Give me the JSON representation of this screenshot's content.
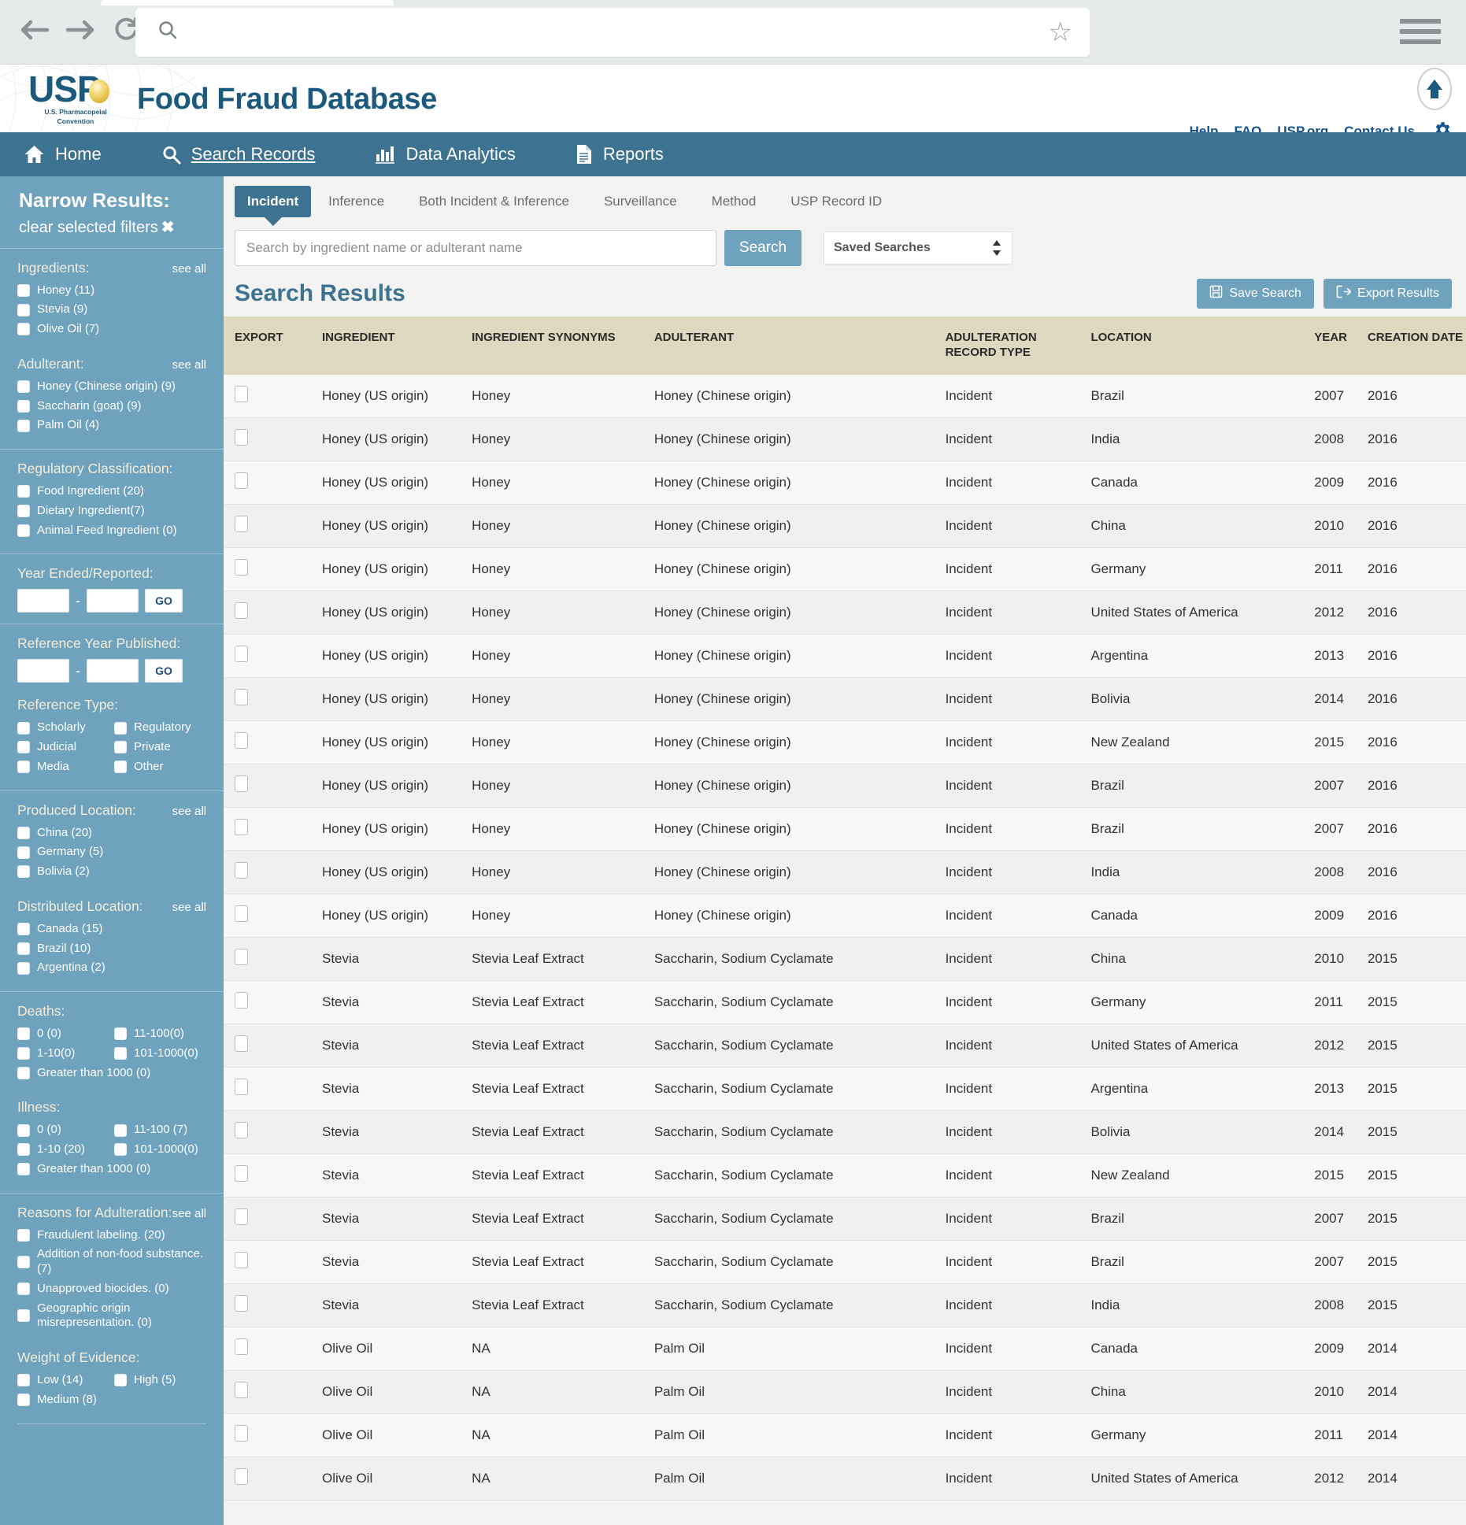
{
  "browser": {
    "url_value": "",
    "back_icon": "back-arrow-icon",
    "forward_icon": "forward-arrow-icon",
    "reload_icon": "reload-icon",
    "search_icon": "search-icon",
    "bookmark_icon": "star-icon",
    "menu_icon": "hamburger-menu-icon"
  },
  "header": {
    "logo_word": "USP",
    "logo_sub_line1": "U.S. Pharmacopeial",
    "logo_sub_line2": "Convention",
    "site_title": "Food Fraud Database",
    "links": [
      "Help",
      "FAQ",
      "USP.org",
      "Contact Us"
    ],
    "gear_icon": "gear-icon",
    "badge_icon": "up-arrow-badge-icon"
  },
  "nav": {
    "items": [
      {
        "label": "Home",
        "icon": "home-icon",
        "active": false
      },
      {
        "label": "Search Records",
        "icon": "magnifier-icon",
        "active": true
      },
      {
        "label": "Data Analytics",
        "icon": "bar-chart-icon",
        "active": false
      },
      {
        "label": "Reports",
        "icon": "document-icon",
        "active": false
      }
    ]
  },
  "sidebar": {
    "title": "Narrow Results:",
    "clear_label": "clear selected filters",
    "clear_icon": "✖",
    "see_all_label": "see all",
    "sections": [
      {
        "name": "ingredients",
        "label": "Ingredients:",
        "see_all": true,
        "options": [
          "Honey (11)",
          "Stevia (9)",
          "Olive Oil (7)"
        ]
      },
      {
        "name": "adulterant",
        "label": "Adulterant:",
        "see_all": true,
        "options": [
          "Honey (Chinese origin) (9)",
          "Saccharin (goat) (9)",
          "Palm Oil (4)"
        ]
      },
      {
        "name": "regulatory-classification",
        "label": "Regulatory Classification:",
        "see_all": false,
        "options": [
          "Food Ingredient (20)",
          "Dietary Ingredient(7)",
          "Animal Feed Ingredient (0)"
        ]
      },
      {
        "name": "produced-location",
        "label": "Produced Location:",
        "see_all": true,
        "options": [
          "China (20)",
          "Germany (5)",
          "Bolivia (2)"
        ]
      },
      {
        "name": "distributed-location",
        "label": "Distributed Location:",
        "see_all": true,
        "options": [
          "Canada (15)",
          "Brazil (10)",
          "Argentina (2)"
        ]
      },
      {
        "name": "reasons-for-adulteration",
        "label": "Reasons for Adulteration:",
        "see_all": true,
        "options": [
          "Fraudulent labeling. (20)",
          "Addition of non-food substance. (7)",
          "Unapproved biocides. (0)",
          "Geographic origin misrepresentation. (0)"
        ]
      }
    ],
    "year_ended": {
      "label": "Year Ended/Reported:",
      "from": "",
      "to": "",
      "go_label": "GO",
      "dash": "-"
    },
    "ref_year": {
      "label": "Reference Year Published:",
      "from": "",
      "to": "",
      "go_label": "GO",
      "dash": "-"
    },
    "reference_type": {
      "label": "Reference Type:",
      "options": [
        "Scholarly",
        "Regulatory",
        "Judicial",
        "Private",
        "Media",
        "Other"
      ]
    },
    "deaths": {
      "label": "Deaths:",
      "options": [
        "0 (0)",
        "11-100(0)",
        "1-10(0)",
        "101-1000(0)",
        "Greater than 1000 (0)"
      ]
    },
    "illness": {
      "label": "Illness:",
      "options": [
        "0 (0)",
        "11-100 (7)",
        "1-10 (20)",
        "101-1000(0)",
        "Greater than 1000 (0)"
      ]
    },
    "weight_of_evidence": {
      "label": "Weight of Evidence:",
      "options": [
        "Low (14)",
        "High (5)",
        "Medium (8)"
      ]
    }
  },
  "main": {
    "tabs": [
      {
        "label": "Incident",
        "active": true
      },
      {
        "label": "Inference",
        "active": false
      },
      {
        "label": "Both Incident & Inference",
        "active": false
      },
      {
        "label": "Surveillance",
        "active": false
      },
      {
        "label": "Method",
        "active": false
      },
      {
        "label": "USP Record ID",
        "active": false
      }
    ],
    "search": {
      "placeholder": "Search by ingredient name or adulterant name",
      "value": "",
      "button_label": "Search"
    },
    "saved_searches": {
      "selected": "Saved Searches",
      "spinner_icon": "updown-spinner-icon"
    },
    "results_title": "Search Results",
    "save_search_label": "Save Search",
    "save_search_icon": "floppy-disk-icon",
    "export_results_label": "Export Results",
    "export_results_icon": "export-icon"
  },
  "table": {
    "columns": [
      "EXPORT",
      "INGREDIENT",
      "INGREDIENT SYNONYMS",
      "ADULTERANT",
      "ADULTERATION RECORD TYPE",
      "LOCATION",
      "YEAR",
      "CREATION DATE"
    ],
    "rows": [
      [
        "Honey (US origin)",
        "Honey",
        "Honey (Chinese origin)",
        "Incident",
        "Brazil",
        "2007",
        "2016"
      ],
      [
        "Honey (US origin)",
        "Honey",
        "Honey (Chinese origin)",
        "Incident",
        "India",
        "2008",
        "2016"
      ],
      [
        "Honey (US origin)",
        "Honey",
        "Honey (Chinese origin)",
        "Incident",
        "Canada",
        "2009",
        "2016"
      ],
      [
        "Honey (US origin)",
        "Honey",
        "Honey (Chinese origin)",
        "Incident",
        "China",
        "2010",
        "2016"
      ],
      [
        "Honey (US origin)",
        "Honey",
        "Honey (Chinese origin)",
        "Incident",
        "Germany",
        "2011",
        "2016"
      ],
      [
        "Honey (US origin)",
        "Honey",
        "Honey (Chinese origin)",
        "Incident",
        "United States of America",
        "2012",
        "2016"
      ],
      [
        "Honey (US origin)",
        "Honey",
        "Honey (Chinese origin)",
        "Incident",
        "Argentina",
        "2013",
        "2016"
      ],
      [
        "Honey (US origin)",
        "Honey",
        "Honey (Chinese origin)",
        "Incident",
        "Bolivia",
        "2014",
        "2016"
      ],
      [
        "Honey (US origin)",
        "Honey",
        "Honey (Chinese origin)",
        "Incident",
        "New Zealand",
        "2015",
        "2016"
      ],
      [
        "Honey (US origin)",
        "Honey",
        "Honey (Chinese origin)",
        "Incident",
        "Brazil",
        "2007",
        "2016"
      ],
      [
        "Honey (US origin)",
        "Honey",
        "Honey (Chinese origin)",
        "Incident",
        "Brazil",
        "2007",
        "2016"
      ],
      [
        "Honey (US origin)",
        "Honey",
        "Honey (Chinese origin)",
        "Incident",
        "India",
        "2008",
        "2016"
      ],
      [
        "Honey (US origin)",
        "Honey",
        "Honey (Chinese origin)",
        "Incident",
        "Canada",
        "2009",
        "2016"
      ],
      [
        "Stevia",
        "Stevia Leaf Extract",
        "Saccharin, Sodium Cyclamate",
        "Incident",
        "China",
        "2010",
        "2015"
      ],
      [
        "Stevia",
        "Stevia Leaf Extract",
        "Saccharin, Sodium Cyclamate",
        "Incident",
        "Germany",
        "2011",
        "2015"
      ],
      [
        "Stevia",
        "Stevia Leaf Extract",
        "Saccharin, Sodium Cyclamate",
        "Incident",
        "United States of America",
        "2012",
        "2015"
      ],
      [
        "Stevia",
        "Stevia Leaf Extract",
        "Saccharin, Sodium Cyclamate",
        "Incident",
        "Argentina",
        "2013",
        "2015"
      ],
      [
        "Stevia",
        "Stevia Leaf Extract",
        "Saccharin, Sodium Cyclamate",
        "Incident",
        "Bolivia",
        "2014",
        "2015"
      ],
      [
        "Stevia",
        "Stevia Leaf Extract",
        "Saccharin, Sodium Cyclamate",
        "Incident",
        "New Zealand",
        "2015",
        "2015"
      ],
      [
        "Stevia",
        "Stevia Leaf Extract",
        "Saccharin, Sodium Cyclamate",
        "Incident",
        "Brazil",
        "2007",
        "2015"
      ],
      [
        "Stevia",
        "Stevia Leaf Extract",
        "Saccharin, Sodium Cyclamate",
        "Incident",
        "Brazil",
        "2007",
        "2015"
      ],
      [
        "Stevia",
        "Stevia Leaf Extract",
        "Saccharin, Sodium Cyclamate",
        "Incident",
        "India",
        "2008",
        "2015"
      ],
      [
        "Olive Oil",
        "NA",
        "Palm Oil",
        "Incident",
        "Canada",
        "2009",
        "2014"
      ],
      [
        "Olive Oil",
        "NA",
        "Palm Oil",
        "Incident",
        "China",
        "2010",
        "2014"
      ],
      [
        "Olive Oil",
        "NA",
        "Palm Oil",
        "Incident",
        "Germany",
        "2011",
        "2014"
      ],
      [
        "Olive Oil",
        "NA",
        "Palm Oil",
        "Incident",
        "United States of America",
        "2012",
        "2014"
      ]
    ]
  },
  "colors": {
    "brand_blue": "#1c5a7d",
    "nav_blue": "#3d7391",
    "sidebar_blue": "#6ea2bd",
    "table_header_tan": "#ddd8bf",
    "link_blue": "#14538f"
  }
}
